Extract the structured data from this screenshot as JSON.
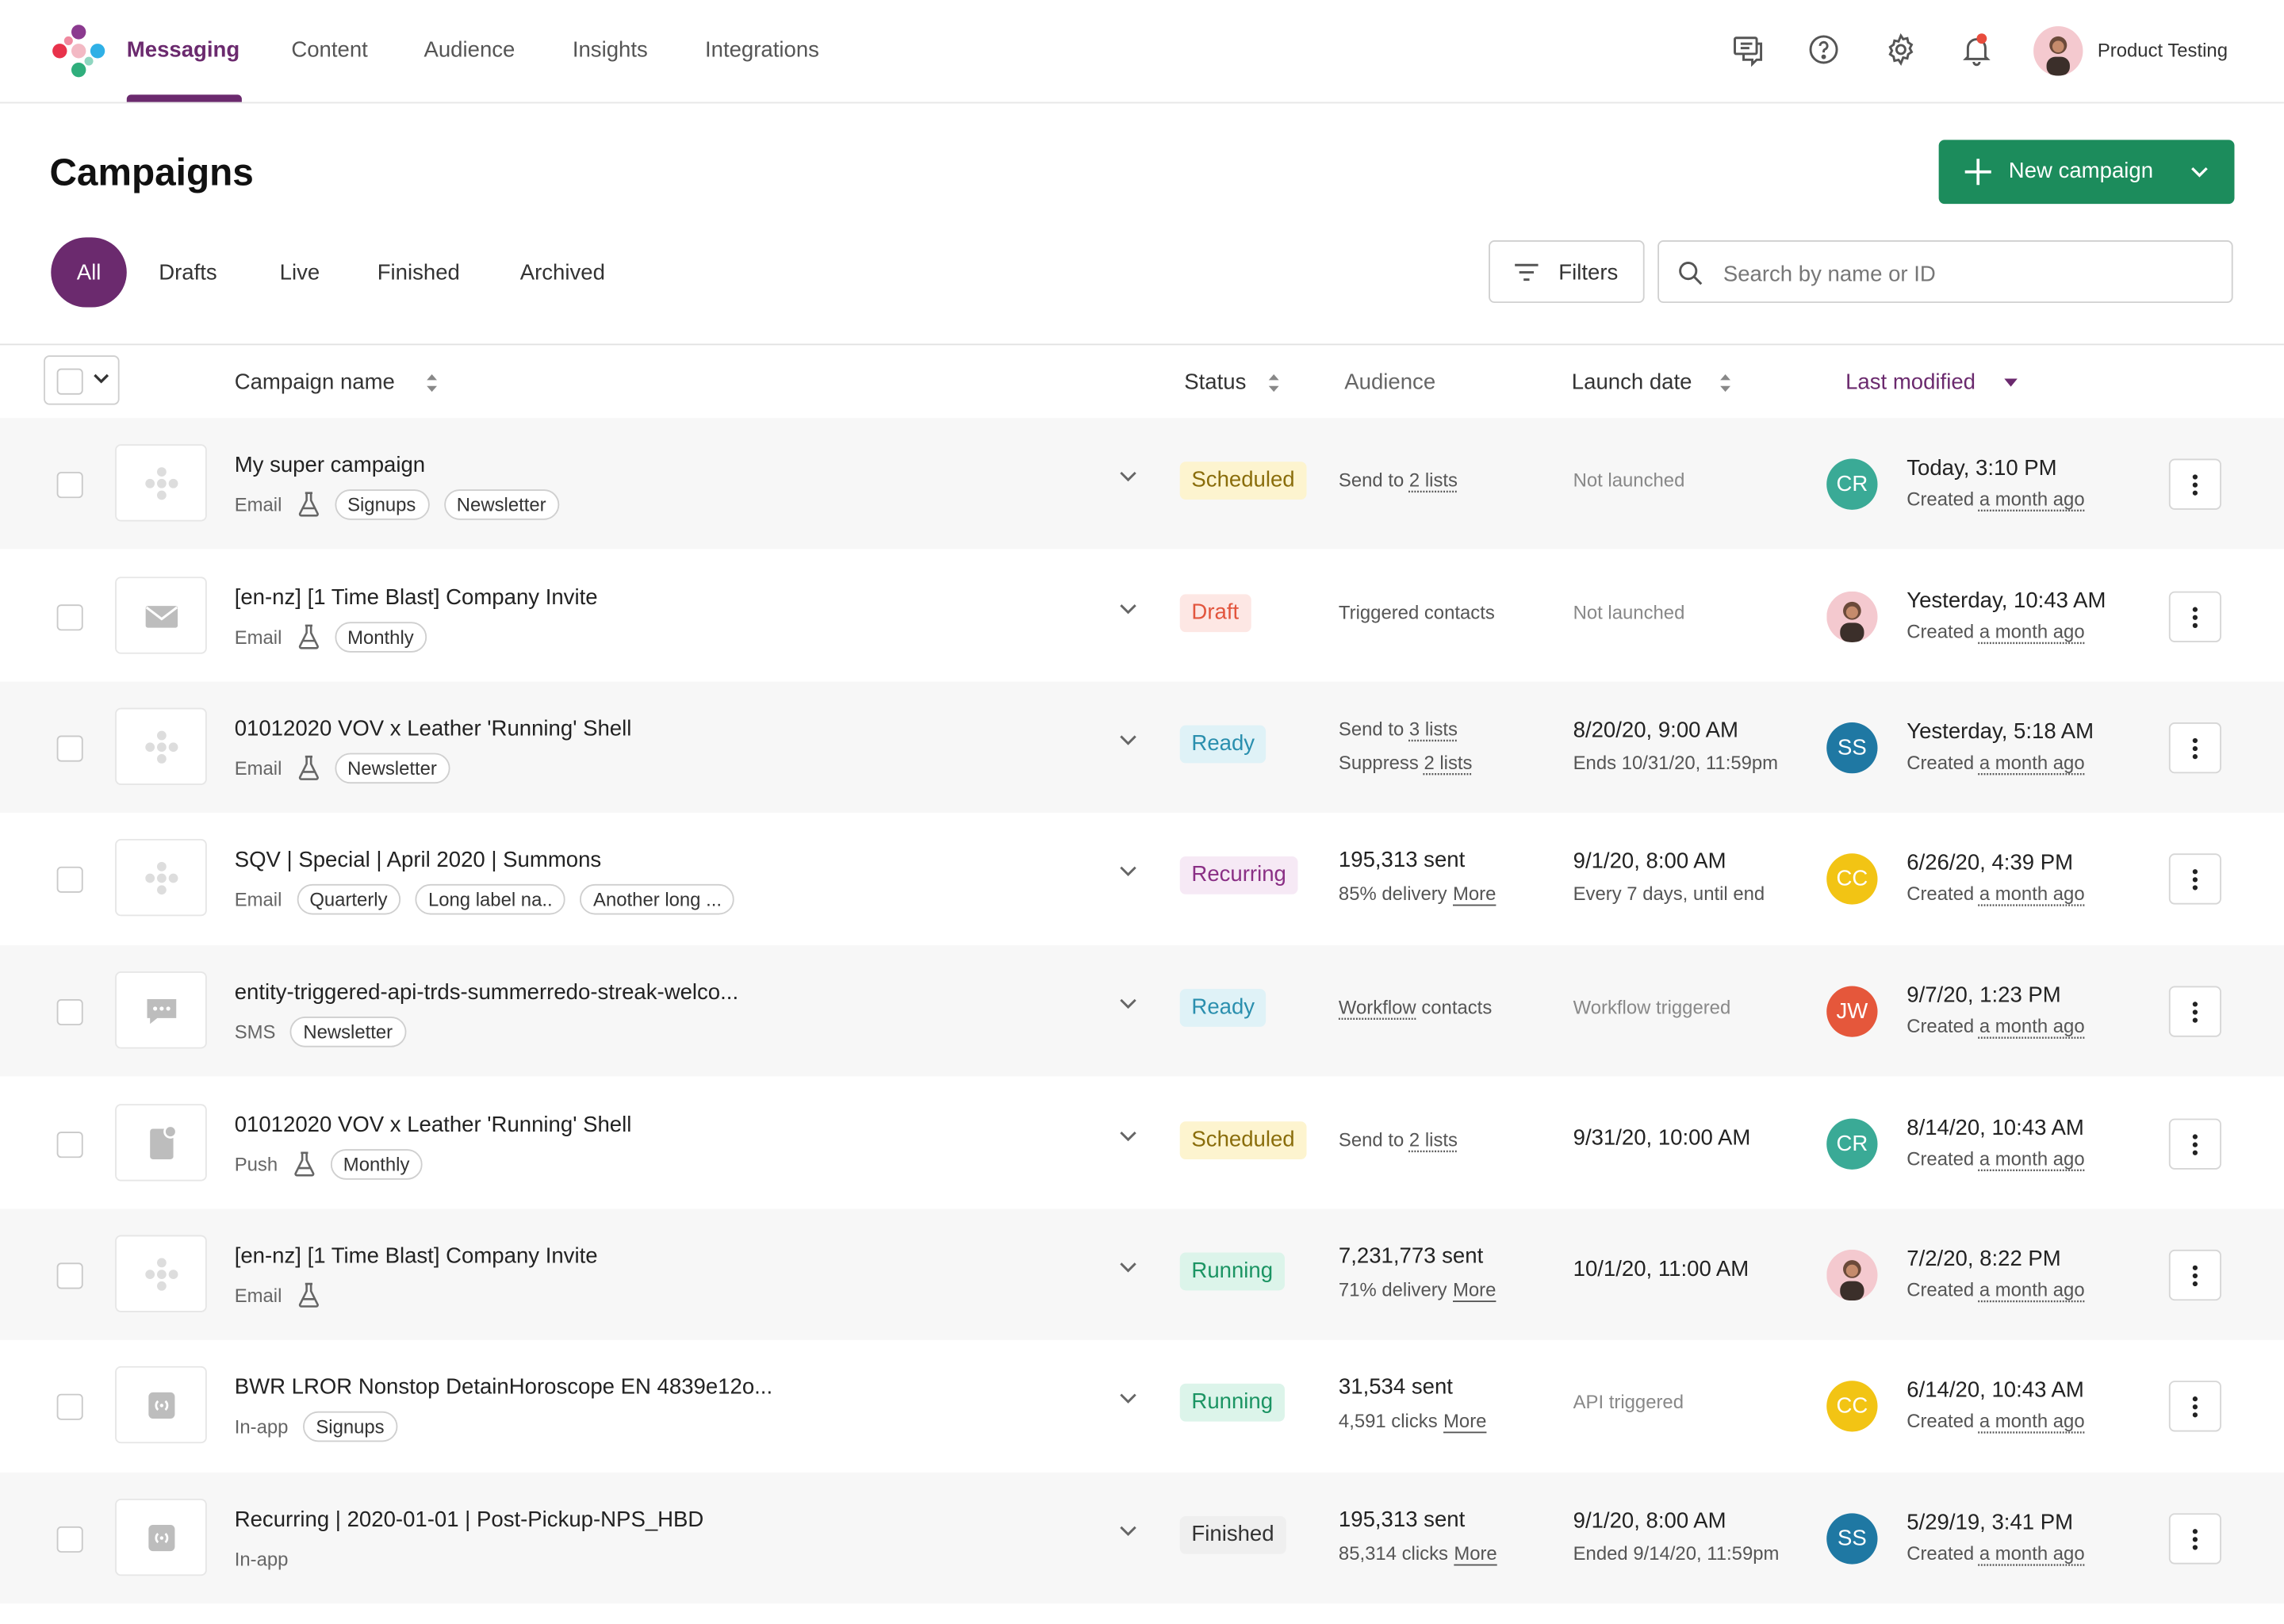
{
  "nav": {
    "items": [
      "Messaging",
      "Content",
      "Audience",
      "Insights",
      "Integrations"
    ],
    "active": "Messaging",
    "user_name": "Product Testing",
    "brand_color": "#6b2a6e",
    "icons": [
      "chat-icon",
      "help-icon",
      "gear-icon",
      "bell-icon"
    ]
  },
  "header": {
    "title": "Campaigns",
    "new_button_label": "New campaign",
    "accent_color": "#1c8c5c"
  },
  "tabs": [
    "All",
    "Drafts",
    "Live",
    "Finished",
    "Archived"
  ],
  "active_tab": "All",
  "filters_label": "Filters",
  "search": {
    "placeholder": "Search by name or ID",
    "value": ""
  },
  "columns": {
    "name": "Campaign name",
    "status": "Status",
    "audience": "Audience",
    "launch": "Launch date",
    "modified": "Last modified"
  },
  "rows": [
    {
      "name": "My super campaign",
      "channel": "Email",
      "test": true,
      "icon": "logo-placeholder-icon",
      "tags": [
        "Signups",
        "Newsletter"
      ],
      "status": "Scheduled",
      "status_class": "b-scheduled",
      "aud_prefix": "Send to",
      "aud_link": "2 lists",
      "launch": "Not launched",
      "owner": "CR",
      "owner_color": "#3aaa96",
      "modified": "Today, 3:10 PM",
      "created_prefix": "Created",
      "created": "a month ago"
    },
    {
      "name": "[en-nz] [1 Time Blast] Company Invite",
      "channel": "Email",
      "test": true,
      "icon": "envelope-icon",
      "tags": [
        "Monthly"
      ],
      "status": "Draft",
      "status_class": "b-draft",
      "aud_text": "Triggered contacts",
      "launch": "Not launched",
      "owner": "photo",
      "modified": "Yesterday, 10:43 AM",
      "created_prefix": "Created",
      "created": "a month ago"
    },
    {
      "name": "01012020 VOV x Leather 'Running' Shell",
      "channel": "Email",
      "test": true,
      "icon": "logo-placeholder-icon",
      "tags": [
        "Newsletter"
      ],
      "status": "Ready",
      "status_class": "b-ready",
      "aud_prefix": "Send to",
      "aud_link": "3 lists",
      "aud2_prefix": "Suppress",
      "aud2_link": "2 lists",
      "launch": "8/20/20, 9:00 AM",
      "launch2": "Ends 10/31/20, 11:59pm",
      "owner": "SS",
      "owner_color": "#1f78a3",
      "modified": "Yesterday, 5:18 AM",
      "created_prefix": "Created",
      "created": "a month ago"
    },
    {
      "name": "SQV | Special | April 2020 | Summons",
      "channel": "Email",
      "test": false,
      "icon": "logo-placeholder-icon",
      "tags": [
        "Quarterly",
        "Long label na..",
        "Another long ..."
      ],
      "status": "Recurring",
      "status_class": "b-recurring",
      "aud_big": "195,313 sent",
      "aud2_text": "85% delivery",
      "aud2_more": "More",
      "launch": "9/1/20, 8:00 AM",
      "launch2": "Every 7 days, until end",
      "owner": "CC",
      "owner_color": "#f2c414",
      "modified": "6/26/20, 4:39 PM",
      "created_prefix": "Created",
      "created": "a month ago"
    },
    {
      "name": "entity-triggered-api-trds-summerredo-streak-welco...",
      "channel": "SMS",
      "test": false,
      "icon": "sms-bubble-icon",
      "tags": [
        "Newsletter"
      ],
      "status": "Ready",
      "status_class": "b-ready",
      "aud_link_first": "Workflow",
      "aud_suffix": "contacts",
      "launch": "Workflow triggered",
      "owner": "JW",
      "owner_color": "#e5573b",
      "modified": "9/7/20, 1:23 PM",
      "created_prefix": "Created",
      "created": "a month ago"
    },
    {
      "name": "01012020 VOV x Leather 'Running' Shell",
      "channel": "Push",
      "test": true,
      "icon": "push-notification-icon",
      "tags": [
        "Monthly"
      ],
      "status": "Scheduled",
      "status_class": "b-scheduled",
      "aud_prefix": "Send to",
      "aud_link": "2 lists",
      "launch": "9/31/20, 10:00 AM",
      "launch_mid": true,
      "owner": "CR",
      "owner_color": "#3aaa96",
      "modified": "8/14/20, 10:43 AM",
      "created_prefix": "Created",
      "created": "a month ago"
    },
    {
      "name": "[en-nz] [1 Time Blast] Company Invite",
      "channel": "Email",
      "test": true,
      "icon": "logo-placeholder-icon",
      "tags": [],
      "status": "Running",
      "status_class": "b-running",
      "aud_big": "7,231,773 sent",
      "aud2_text": "71% delivery",
      "aud2_more": "More",
      "launch": "10/1/20, 11:00 AM",
      "launch_mid": true,
      "owner": "photo",
      "modified": "7/2/20, 8:22 PM",
      "created_prefix": "Created",
      "created": "a month ago"
    },
    {
      "name": "BWR LROR Nonstop DetainHoroscope EN 4839e12o...",
      "channel": "In-app",
      "test": false,
      "icon": "in-app-icon",
      "tags": [
        "Signups"
      ],
      "status": "Running",
      "status_class": "b-running",
      "aud_big": "31,534 sent",
      "aud2_text": "4,591 clicks",
      "aud2_more": "More",
      "launch": "API triggered",
      "owner": "CC",
      "owner_color": "#f2c414",
      "modified": "6/14/20, 10:43 AM",
      "created_prefix": "Created",
      "created": "a month ago"
    },
    {
      "name": "Recurring | 2020-01-01 | Post-Pickup-NPS_HBD",
      "channel": "In-app",
      "test": false,
      "icon": "in-app-icon",
      "tags": [],
      "status": "Finished",
      "status_class": "b-finished",
      "aud_big": "195,313 sent",
      "aud2_text": "85,314 clicks",
      "aud2_more": "More",
      "launch": "9/1/20, 8:00 AM",
      "launch2": "Ended 9/14/20, 11:59pm",
      "owner": "SS",
      "owner_color": "#1f78a3",
      "modified": "5/29/19, 3:41 PM",
      "created_prefix": "Created",
      "created": "a month ago"
    }
  ]
}
